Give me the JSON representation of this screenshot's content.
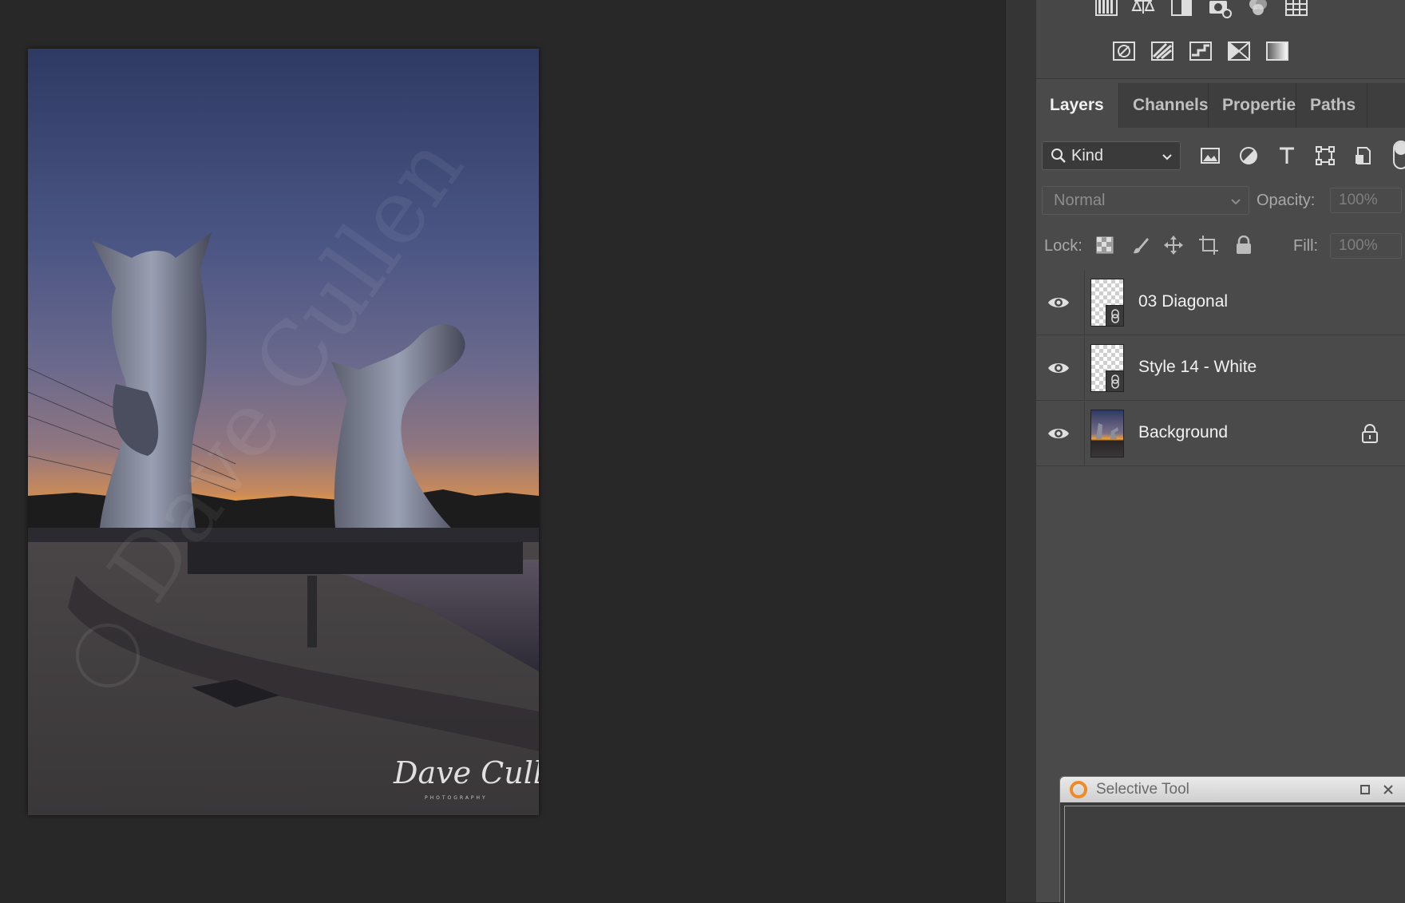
{
  "canvas": {
    "image_subject": "photo",
    "signature": "Dave Cullen",
    "signature_sub": "PHOTOGRAPHY",
    "watermark": "© Dave Cullen"
  },
  "adjustments": {
    "row1": [
      "levels-icon",
      "curves-balance-icon",
      "exposure-icon",
      "camera-raw-icon",
      "channel-mixer-icon",
      "grid-icon"
    ],
    "row2": [
      "invert-icon",
      "posterize-icon",
      "threshold-icon",
      "selective-color-icon",
      "gradient-map-icon"
    ]
  },
  "tabs": [
    "Layers",
    "Channels",
    "Propertie",
    "Paths"
  ],
  "active_tab": "Layers",
  "filter": {
    "kind_label": "Kind"
  },
  "blend": {
    "mode": "Normal",
    "opacity_label": "Opacity:",
    "opacity_value": "100%"
  },
  "lock": {
    "label": "Lock:",
    "fill_label": "Fill:",
    "fill_value": "100%"
  },
  "layers": [
    {
      "name": "03 Diagonal",
      "type": "smart-object",
      "visible": true,
      "locked": false
    },
    {
      "name": "Style 14 - White",
      "type": "smart-object",
      "visible": true,
      "locked": false
    },
    {
      "name": "Background",
      "type": "image",
      "visible": true,
      "locked": true
    }
  ],
  "selective_tool": {
    "title": "Selective Tool"
  },
  "colors": {
    "app_bg": "#282828",
    "panel_bg": "#4a4a4a",
    "accent_logo": "#f08a24"
  }
}
